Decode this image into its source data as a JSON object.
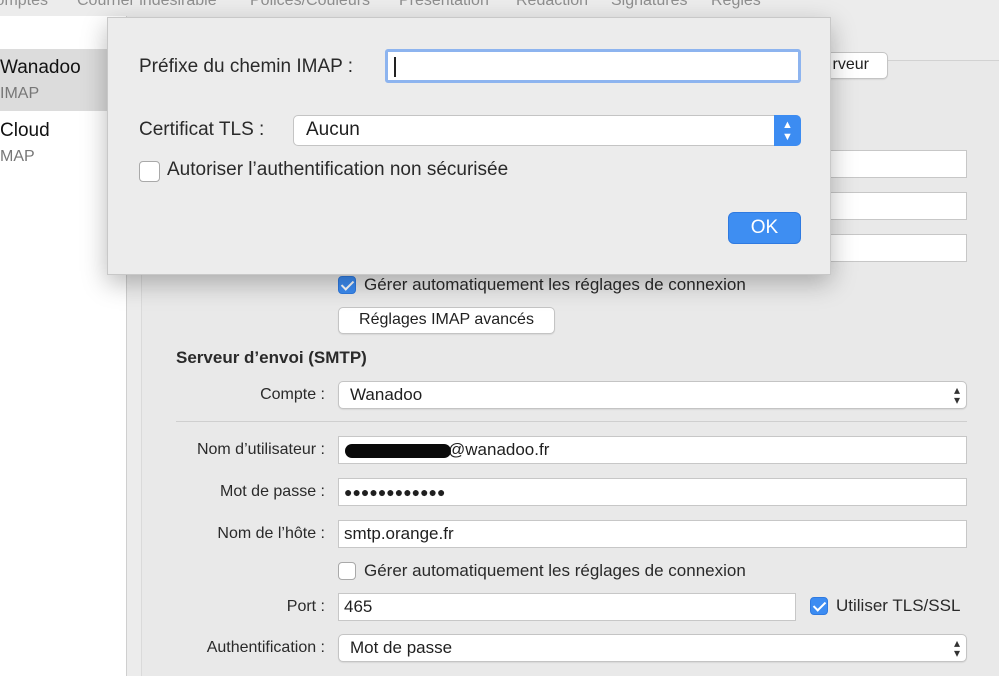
{
  "toolbar": {
    "tabs": [
      "Comptes",
      "Courrier indésirable",
      "Polices/Couleurs",
      "Présentation",
      "Rédaction",
      "Signatures",
      "Règles"
    ]
  },
  "sidebar": {
    "accounts": [
      {
        "name": "Wanadoo",
        "type": "IMAP"
      },
      {
        "name": "Cloud",
        "type": "MAP"
      }
    ]
  },
  "incoming": {
    "server_button_fragment": "rveur",
    "auto_settings_label": "Gérer automatiquement les réglages de connexion",
    "auto_settings_checked": true,
    "advanced_button": "Réglages IMAP avancés"
  },
  "smtp": {
    "section_title": "Serveur d’envoi (SMTP)",
    "account_label": "Compte :",
    "account_value": "Wanadoo",
    "username_label": "Nom d’utilisateur :",
    "username_value": "@wanadoo.fr",
    "password_label": "Mot de passe :",
    "password_value": "●●●●●●●●●●●●",
    "host_label": "Nom de l’hôte :",
    "host_value": "smtp.orange.fr",
    "auto_settings_label": "Gérer automatiquement les réglages de connexion",
    "auto_settings_checked": false,
    "port_label": "Port :",
    "port_value": "465",
    "tls_label": "Utiliser TLS/SSL",
    "tls_checked": true,
    "auth_label": "Authentification :",
    "auth_value": "Mot de passe"
  },
  "sheet": {
    "imap_prefix_label": "Préfixe du chemin IMAP :",
    "imap_prefix_value": "",
    "tls_cert_label": "Certificat TLS :",
    "tls_cert_value": "Aucun",
    "insecure_auth_label": "Autoriser l’authentification non sécurisée",
    "insecure_auth_checked": false,
    "ok_label": "OK"
  },
  "colors": {
    "accent": "#3c8cf2",
    "window_bg": "#ececec"
  }
}
